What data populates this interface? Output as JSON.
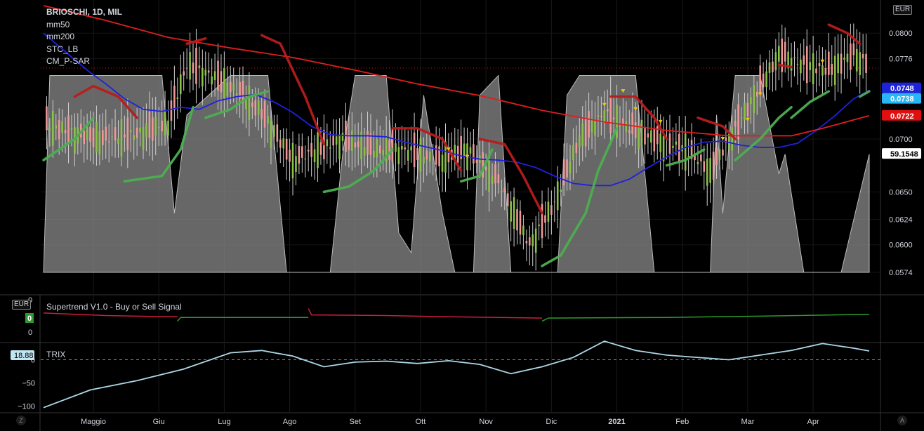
{
  "legend": {
    "title": "BRIOSCHI, 1D, MIL",
    "lines": [
      "mm50",
      "mm200",
      "STC_LB",
      "CM_P-SAR"
    ]
  },
  "panes": {
    "supertrend_title": "Supertrend V1.0 - Buy or Sell Signal",
    "trix_title": "TRIX"
  },
  "currency": "EUR",
  "corners": {
    "left": "Z",
    "right": "A"
  },
  "colors": {
    "up": "#8bc34a",
    "down": "#ef9a9a",
    "mm50": "#2020e0",
    "mm200": "#e01e1e",
    "stc": "#8a8a8a",
    "sar_up": "#4caf50",
    "sar_down": "#b71c1c",
    "st_up": "#2e9a2e",
    "st_down": "#cc1f3b",
    "trix": "#add8e6",
    "signal": "#f2c511"
  },
  "chart_data": [
    {
      "type": "candlestick",
      "title": "BRIOSCHI, 1D, MIL",
      "ylim": [
        0.0566,
        0.0826
      ],
      "y_ticks": [
        "0.0800",
        "0.0776",
        "0.0700",
        "0.0650",
        "0.0624",
        "0.0600",
        "0.0574"
      ],
      "x_ticks": [
        "Maggio",
        "Giu",
        "Lug",
        "Ago",
        "Set",
        "Ott",
        "Nov",
        "Dic",
        "2021",
        "Feb",
        "Mar",
        "Apr"
      ],
      "price_labels": [
        {
          "text": "0.0748",
          "value": 0.0748,
          "color": "#1e22d8"
        },
        {
          "text": "0.0738",
          "value": 0.0738,
          "color": "#29b6f6"
        },
        {
          "text": "0.0722",
          "value": 0.0722,
          "color": "#e01010"
        },
        {
          "text": "59.1548",
          "value": 0.0686,
          "color": "#ffffff"
        }
      ],
      "dotted_level": 0.0767,
      "series": [
        {
          "name": "mm50",
          "x": [
            0,
            8,
            14,
            20,
            26,
            32,
            38,
            44,
            50,
            56,
            62,
            68,
            74,
            80,
            86,
            92,
            98,
            104,
            110,
            116,
            122,
            128,
            134,
            140,
            146,
            152,
            158,
            164,
            170,
            176,
            182,
            188,
            194,
            200,
            206,
            212,
            218,
            224,
            230,
            236,
            242,
            248,
            254,
            260,
            265
          ],
          "y": [
            0.08,
            0.078,
            0.0765,
            0.0752,
            0.0738,
            0.0728,
            0.0726,
            0.073,
            0.0728,
            0.0736,
            0.074,
            0.0742,
            0.0735,
            0.0725,
            0.0712,
            0.0704,
            0.0703,
            0.0703,
            0.0702,
            0.0697,
            0.0693,
            0.0689,
            0.0684,
            0.0681,
            0.068,
            0.0678,
            0.0673,
            0.0665,
            0.0658,
            0.0656,
            0.0656,
            0.0662,
            0.0673,
            0.0683,
            0.0692,
            0.0697,
            0.0698,
            0.0694,
            0.0692,
            0.0692,
            0.0696,
            0.0708,
            0.0722,
            0.0738,
            0.0746
          ]
        },
        {
          "name": "mm200",
          "x": [
            0,
            20,
            40,
            60,
            80,
            100,
            120,
            140,
            160,
            180,
            200,
            220,
            240,
            250,
            265
          ],
          "y": [
            0.0826,
            0.0812,
            0.0796,
            0.0786,
            0.0777,
            0.0765,
            0.0752,
            0.0741,
            0.0727,
            0.0716,
            0.0708,
            0.0703,
            0.0703,
            0.071,
            0.0722
          ]
        }
      ]
    },
    {
      "type": "line",
      "title": "Supertrend V1.0 - Buy or Sell Signal",
      "y_ticks": [
        "0",
        "0"
      ],
      "series": [
        {
          "name": "sell",
          "x": [
            0,
            20,
            40,
            43
          ],
          "y": [
            0.9,
            0.5,
            0.3,
            0.3
          ]
        },
        {
          "name": "buy",
          "x": [
            43,
            44,
            60,
            85
          ],
          "y": [
            -0.4,
            0.2,
            0.2,
            0.2
          ]
        },
        {
          "name": "sell",
          "x": [
            85,
            86,
            110,
            130,
            160
          ],
          "y": [
            1.6,
            0.6,
            0.5,
            0.3,
            0.1
          ]
        },
        {
          "name": "buy",
          "x": [
            160,
            162,
            200,
            230,
            265
          ],
          "y": [
            -0.4,
            0.1,
            0.2,
            0.4,
            0.7
          ]
        }
      ]
    },
    {
      "type": "line",
      "title": "TRIX",
      "current_value": "18.88",
      "y_ticks": [
        "0",
        "−50",
        "−100"
      ],
      "ylim": [
        -108,
        28
      ],
      "series": [
        {
          "name": "TRIX",
          "x": [
            0,
            15,
            30,
            45,
            60,
            70,
            80,
            90,
            100,
            110,
            120,
            130,
            140,
            150,
            160,
            170,
            180,
            190,
            200,
            210,
            220,
            230,
            240,
            250,
            260,
            265
          ],
          "y": [
            -103,
            -65,
            -45,
            -20,
            15,
            20,
            8,
            -15,
            -5,
            -3,
            -8,
            -2,
            -10,
            -30,
            -15,
            5,
            40,
            20,
            10,
            5,
            0,
            10,
            20,
            35,
            25,
            19
          ]
        }
      ]
    }
  ]
}
